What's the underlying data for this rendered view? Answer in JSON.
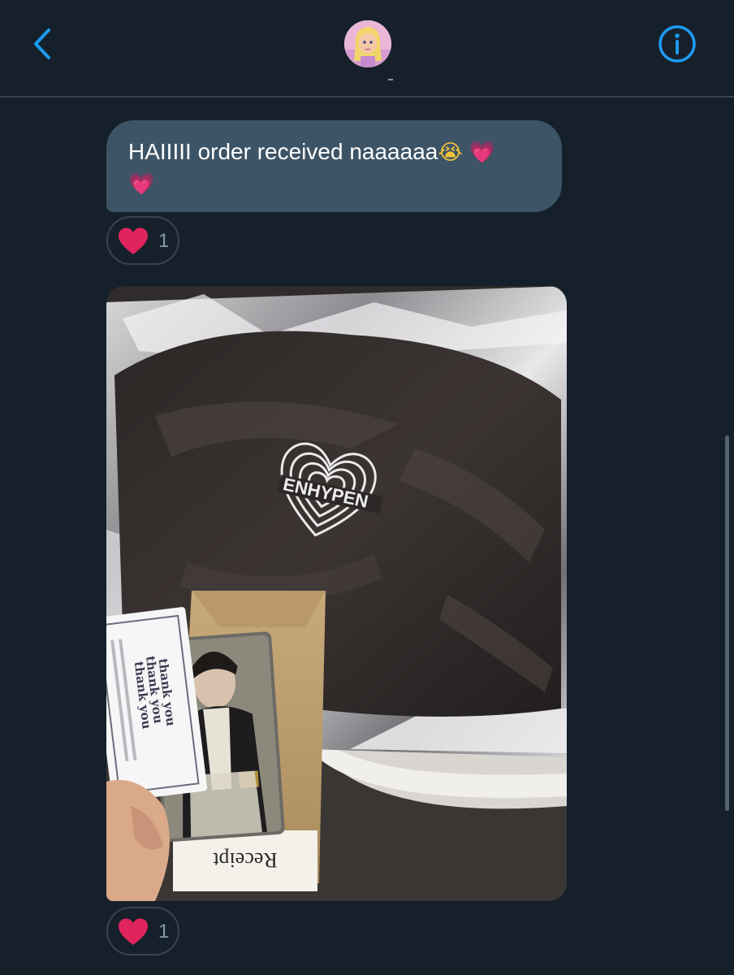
{
  "header": {
    "back_icon": "chevron-left-icon",
    "info_icon": "info-circle-icon",
    "avatar_alt": "avatar",
    "accent_color": "#1d9bf0"
  },
  "messages": [
    {
      "type": "text",
      "text": "HAIIIII order received naaaaaa",
      "emojis": [
        "😭",
        "💗",
        "💗"
      ],
      "reaction": {
        "icon": "heart-icon",
        "count": "1"
      }
    },
    {
      "type": "photo",
      "photo_texts": {
        "logo": "ENHYPEN",
        "card_line_1": "thank you",
        "card_line_2": "thank you",
        "card_line_3": "thank you",
        "receipt": "Receipt"
      },
      "reaction": {
        "icon": "heart-icon",
        "count": "1"
      }
    }
  ],
  "colors": {
    "background": "#15202b",
    "bubble": "#3d5466",
    "divider": "#38444d",
    "reaction_heart": "#e0245e",
    "muted_text": "#8899a6"
  }
}
